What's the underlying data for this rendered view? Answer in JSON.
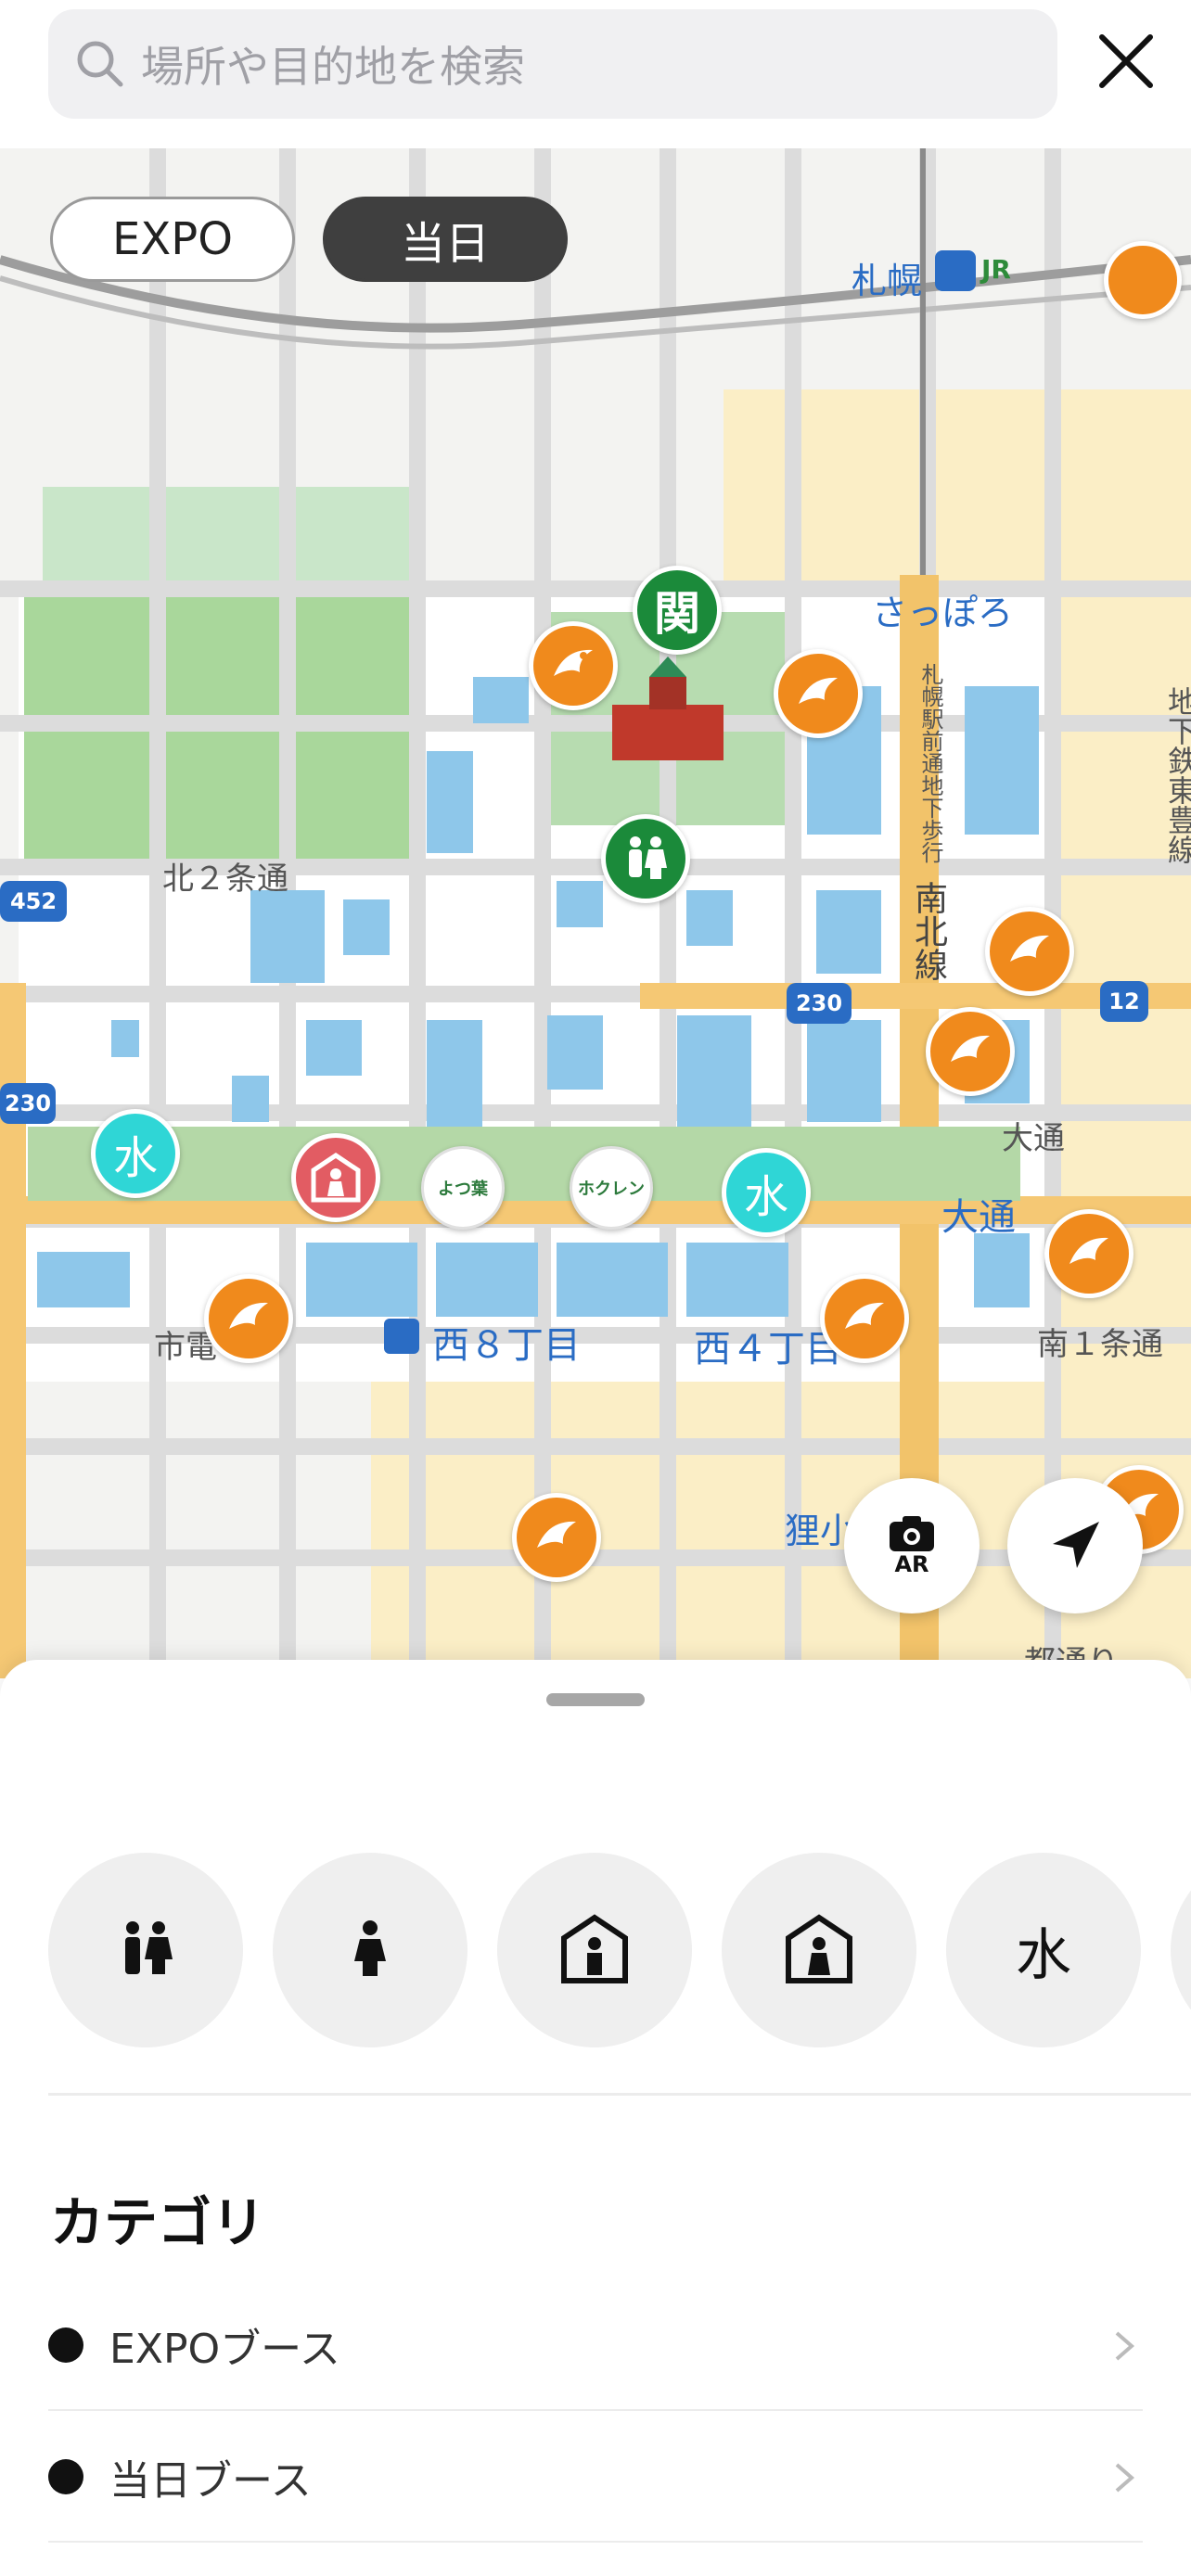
{
  "search": {
    "placeholder": "場所や目的地を検索"
  },
  "map": {
    "toggle": {
      "expo_label": "EXPO",
      "today_label": "当日",
      "selected": "当日"
    },
    "labels": {
      "sapporo_station": "札幌",
      "sapporo_subway": "さっぽろ",
      "kita2": "北２条通",
      "nishi8": "西８丁目",
      "nishi4": "西４丁目",
      "odori": "大通",
      "odori_small": "大通",
      "minami1": "南１条通",
      "shiden": "市電",
      "tanuki": "狸小",
      "nanboku": "南北線",
      "chikatetsu_toho": "地下鉄東豊線",
      "underground_walkway": "札幌駅前通地下歩行",
      "miyako": "都通り",
      "route_452": "452",
      "route_230a": "230",
      "route_230b": "230",
      "route_12": "12",
      "kan": "関",
      "water_a": "水",
      "water_b": "水",
      "logo_yotsuba": "よつ葉",
      "logo_hokuren": "ホクレン",
      "jr": "JR"
    },
    "ar_label": "AR"
  },
  "sheet": {
    "filters": [
      {
        "icon": "restroom-icon"
      },
      {
        "icon": "womens-restroom-icon"
      },
      {
        "icon": "multipurpose-restroom-icon"
      },
      {
        "icon": "nursing-room-icon"
      },
      {
        "icon": "water-icon",
        "label": "水"
      }
    ],
    "category_title": "カテゴリ",
    "categories": [
      {
        "label": "EXPOブース"
      },
      {
        "label": "当日ブース"
      }
    ]
  },
  "colors": {
    "orange_pin": "#f08a1c",
    "green_pin": "#1b8a3a",
    "water_pin": "#2fd6d6",
    "toggle_selected": "#3f3f3f"
  }
}
